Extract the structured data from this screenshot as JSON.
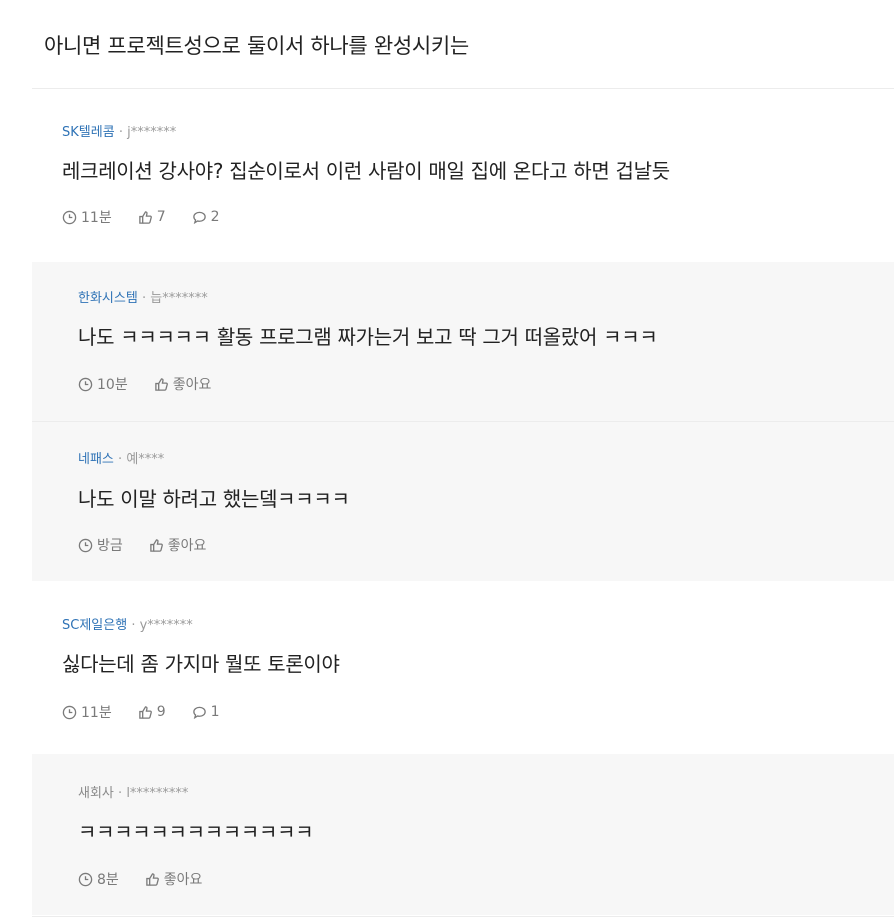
{
  "post_line": "아니면 프로젝트성으로 둘이서 하나를 완성시키는",
  "comments": [
    {
      "company": "SK텔레콤",
      "author": "j*******",
      "body": "레크레이션 강사야? 집순이로서 이런 사람이 매일 집에 온다고 하면 겁날듯",
      "time": "11분",
      "likes": "7",
      "replies": "2"
    },
    {
      "company": "한화시스템",
      "author": "늡*******",
      "body": "나도 ㅋㅋㅋㅋㅋ 활동 프로그램 짜가는거 보고 딱 그거 떠올랐어 ㅋㅋㅋ",
      "time": "10분",
      "like_label": "좋아요"
    },
    {
      "company": "네패스",
      "author": "예****",
      "body": "나도 이말 하려고 했는뎈ㅋㅋㅋㅋ",
      "time": "방금",
      "like_label": "좋아요"
    },
    {
      "company": "SC제일은행",
      "author": "y*******",
      "body": "싫다는데 좀 가지마 뭘또 토론이야",
      "time": "11분",
      "likes": "9",
      "replies": "1"
    },
    {
      "company": "새회사",
      "author": "l*********",
      "body": "ㅋㅋㅋㅋㅋㅋㅋㅋㅋㅋㅋㅋㅋ",
      "time": "8분",
      "like_label": "좋아요"
    }
  ],
  "meta_separator": "·",
  "icons": {
    "time": "clock-icon",
    "like": "thumbs-up-icon",
    "reply": "speech-bubble-icon"
  },
  "colors": {
    "company_link": "#2f73b6",
    "muted": "#7a7a7a",
    "reply_bg": "#f7f7f7"
  }
}
